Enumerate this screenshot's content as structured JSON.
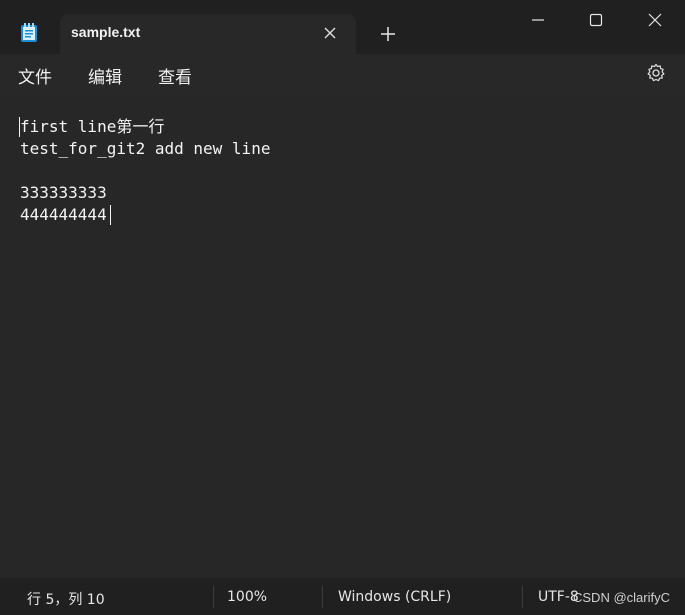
{
  "titlebar": {
    "app_icon": "notepad-icon",
    "tab": {
      "title": "sample.txt",
      "close_icon": "close-icon"
    },
    "new_tab_icon": "plus-icon",
    "window_controls": {
      "minimize_icon": "minimize-icon",
      "maximize_icon": "maximize-icon",
      "close_icon": "close-icon"
    }
  },
  "menubar": {
    "items": [
      {
        "label": "文件"
      },
      {
        "label": "编辑"
      },
      {
        "label": "查看"
      }
    ],
    "settings_icon": "gear-icon"
  },
  "editor": {
    "lines": [
      "first line第一行",
      "test_for_git2 add new line",
      "",
      "333333333",
      "444444444"
    ]
  },
  "statusbar": {
    "position": "行 5，列 10",
    "zoom": "100%",
    "line_ending": "Windows (CRLF)",
    "encoding": "UTF-8",
    "watermark": "CSDN @clarifyC"
  },
  "colors": {
    "titlebar_bg": "#202020",
    "editor_bg": "#272727",
    "text": "#f4f4f4",
    "icon_accent": "#4ab3e8"
  }
}
